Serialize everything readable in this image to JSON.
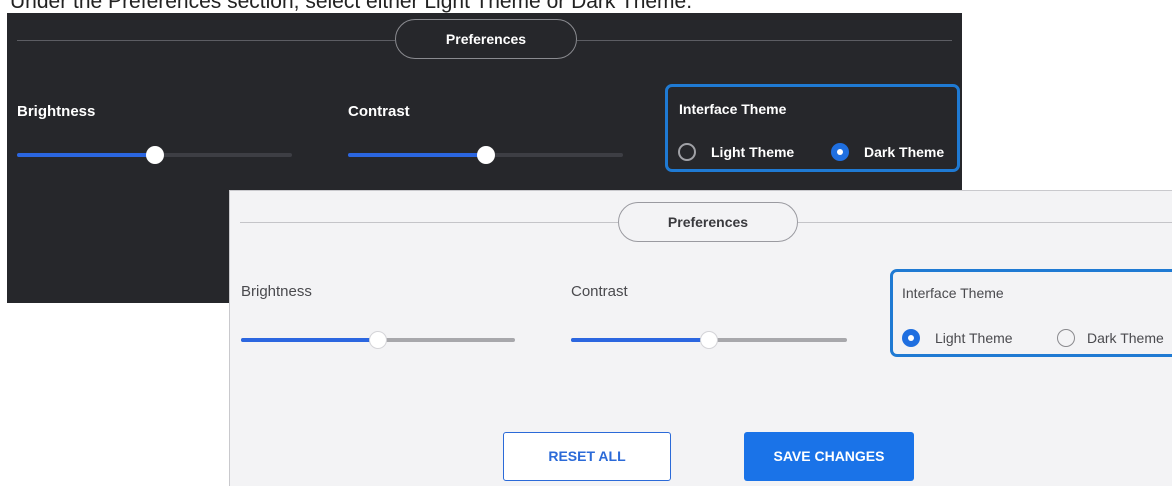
{
  "instruction": "Under the Preferences section, select either Light Theme or Dark Theme.",
  "dark_panel": {
    "section_title": "Preferences",
    "brightness_label": "Brightness",
    "brightness_value": 0.5,
    "contrast_label": "Contrast",
    "contrast_value": 0.5,
    "theme_group_label": "Interface Theme",
    "theme_options": [
      "Light Theme",
      "Dark Theme"
    ],
    "selected_theme": "Dark Theme"
  },
  "light_panel": {
    "section_title": "Preferences",
    "brightness_label": "Brightness",
    "brightness_value": 0.5,
    "contrast_label": "Contrast",
    "contrast_value": 0.5,
    "theme_group_label": "Interface Theme",
    "theme_options": [
      "Light Theme",
      "Dark Theme"
    ],
    "selected_theme": "Light Theme",
    "reset_label": "RESET ALL",
    "save_label": "SAVE CHANGES"
  },
  "colors": {
    "accent": "#2b66e0",
    "highlight_border": "#1f7ad3",
    "dark_bg": "#26272b",
    "light_bg": "#f3f3f5",
    "save_button": "#1a73e8"
  }
}
